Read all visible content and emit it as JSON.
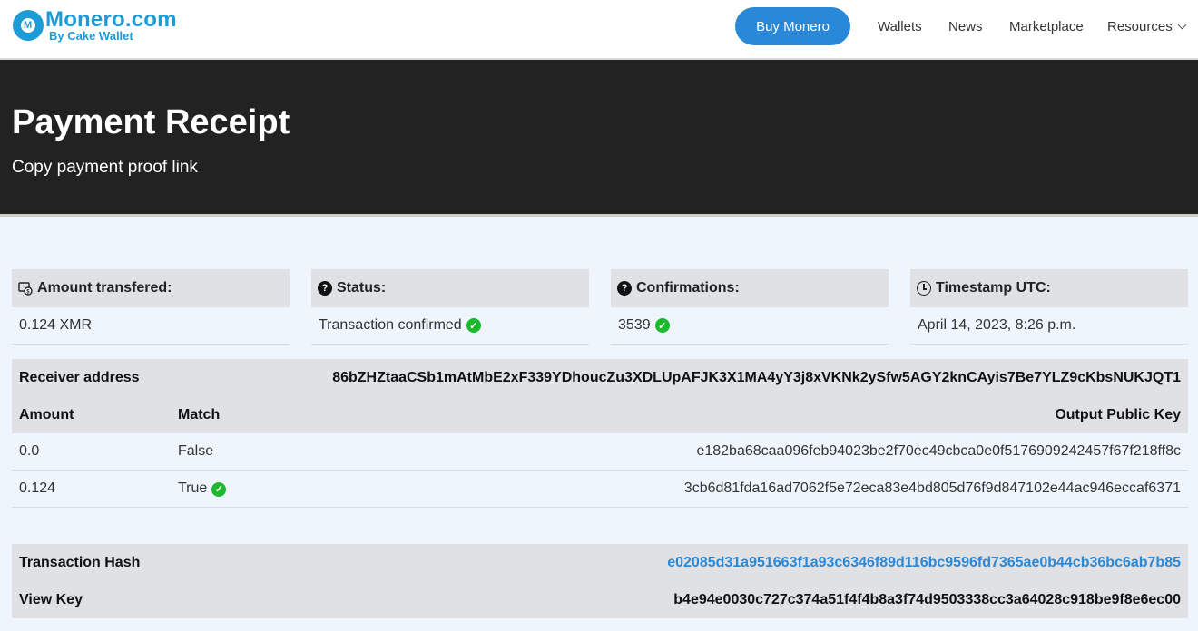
{
  "header": {
    "logo_title": "Monero.com",
    "logo_subtitle": "By Cake Wallet",
    "buy_button": "Buy Monero",
    "nav": [
      "Wallets",
      "News",
      "Marketplace",
      "Resources"
    ],
    "brand_color": "#1d9bd7"
  },
  "hero": {
    "title": "Payment Receipt",
    "subtitle": "Copy payment proof link"
  },
  "cards": [
    {
      "label": "Amount transfered:",
      "value": "0.124 XMR",
      "icon": "money-icon"
    },
    {
      "label": "Status:",
      "value": "Transaction confirmed",
      "icon": "question-icon",
      "confirmed": true
    },
    {
      "label": "Confirmations:",
      "value": "3539",
      "icon": "question-icon",
      "confirmed": true
    },
    {
      "label": "Timestamp UTC:",
      "value": "April 14, 2023, 8:26 p.m.",
      "icon": "clock-icon"
    }
  ],
  "receiver": {
    "label": "Receiver address",
    "value": "86bZHZtaaCSb1mAtMbE2xF339YDhoucZu3XDLUpAFJK3X1MA4yY3j8xVKNk2ySfw5AGY2knCAyis7Be7YLZ9cKbsNUKJQT1"
  },
  "outputs": {
    "columns": [
      "Amount",
      "Match",
      "Output Public Key"
    ],
    "rows": [
      {
        "amount": "0.0",
        "match": "False",
        "key": "e182ba68caa096feb94023be2f70ec49cbca0e0f5176909242457f67f218ff8c"
      },
      {
        "amount": "0.124",
        "match": "True",
        "key": "3cb6d81fda16ad7062f5e72eca83e4bd805d76f9d847102e44ac946eccaf6371"
      }
    ]
  },
  "tx": {
    "hash_label": "Transaction Hash",
    "hash_value": "e02085d31a951663f1a93c6346f89d116bc9596fd7365ae0b44cb36bc6ab7b85",
    "viewkey_label": "View Key",
    "viewkey_value": "b4e94e0030c727c374a51f4f4b8a3f74d9503338cc3a64028c918be9f8e6ec00"
  }
}
